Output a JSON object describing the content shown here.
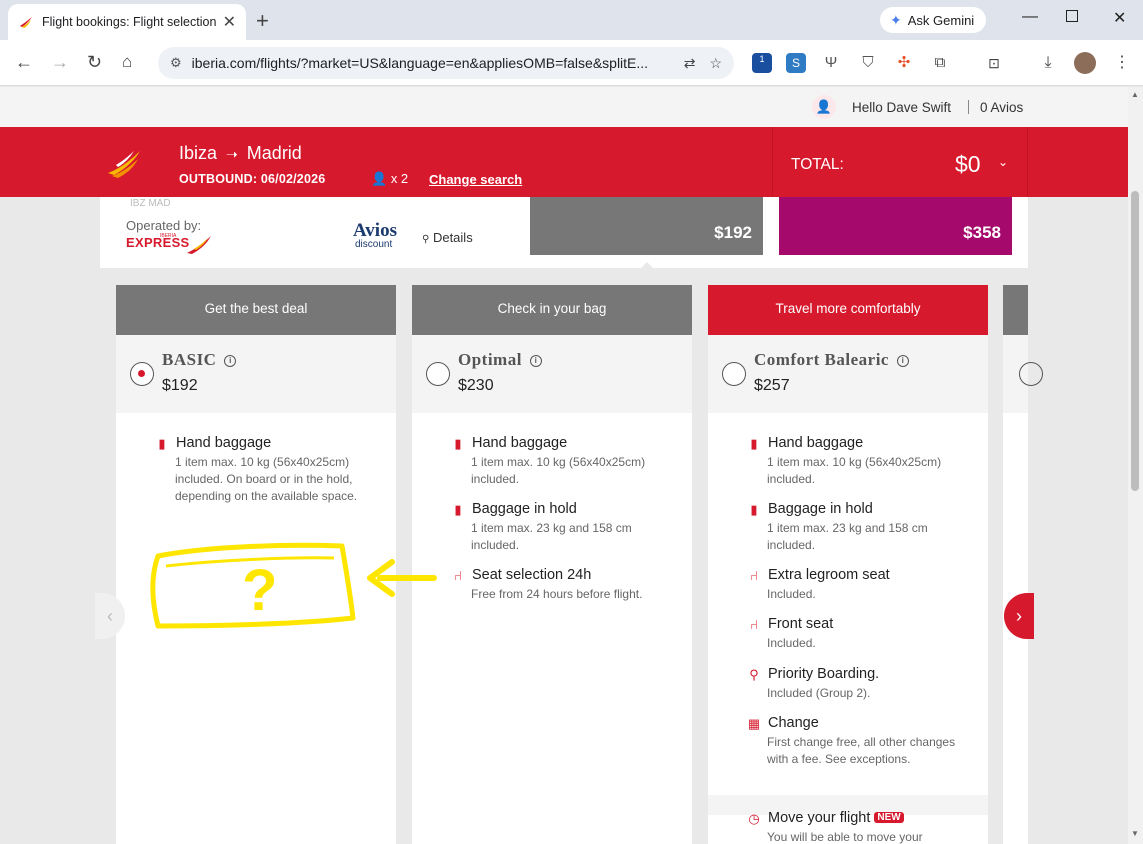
{
  "browser": {
    "tab_title": "Flight bookings: Flight selection",
    "close_tab": "✕",
    "new_tab": "+",
    "gemini_label": "Ask Gemini",
    "url": "iberia.com/flights/?market=US&language=en&appliesOMB=false&splitE...",
    "ext_badge": "1"
  },
  "header": {
    "greeting": "Hello Dave Swift",
    "avios": "0 Avios"
  },
  "booking": {
    "origin": "Ibiza",
    "arrow": "➝",
    "destination": "Madrid",
    "outbound": "OUTBOUND: 06/02/2026",
    "passengers": "x 2",
    "change_search": "Change search",
    "total_label": "TOTAL:",
    "total_value": "$0",
    "total_chevron": "⌄"
  },
  "flight": {
    "cut_codes": "IBZ                                                                 MAD",
    "operated_by": "Operated by:",
    "carrier": "EXPRESS",
    "carrier_sub": "IBERIA",
    "avios_word": "Avios",
    "avios_discount": "discount",
    "details": "Details",
    "price_economy": "$192",
    "price_business": "$358"
  },
  "fares": [
    {
      "header": "Get the best deal",
      "name": "BASIC",
      "price": "$192",
      "features": [
        {
          "title": "Hand baggage",
          "desc": "1 item max. 10 kg (56x40x25cm) included. On board or in the hold, depending on the available space."
        }
      ]
    },
    {
      "header": "Check in your bag",
      "name": "Optimal",
      "price": "$230",
      "features": [
        {
          "title": "Hand baggage",
          "desc": "1 item max. 10 kg (56x40x25cm) included."
        },
        {
          "title": "Baggage in hold",
          "desc": "1 item max. 23 kg and 158 cm included."
        },
        {
          "title": "Seat selection 24h",
          "desc": "Free from 24 hours before flight."
        }
      ]
    },
    {
      "header": "Travel more comfortably",
      "name": "Comfort Balearic",
      "price": "$257",
      "features": [
        {
          "title": "Hand baggage",
          "desc": "1 item max. 10 kg (56x40x25cm) included."
        },
        {
          "title": "Baggage in hold",
          "desc": "1 item max. 23 kg and 158 cm included."
        },
        {
          "title": "Extra legroom seat",
          "desc": "Included."
        },
        {
          "title": "Front seat",
          "desc": "Included."
        },
        {
          "title": "Priority Boarding.",
          "desc": "Included (Group 2)."
        },
        {
          "title": "Change",
          "desc": "First change free, all other changes with a fee. See exceptions."
        },
        {
          "title": "Move your flight",
          "badge": "NEW",
          "desc": "You will be able to move your"
        }
      ]
    }
  ],
  "annotation": {
    "mark": "?"
  },
  "colors": {
    "brand_red": "#d7192d",
    "economy_grey": "#777777",
    "business_purple": "#a5096b",
    "annotation_yellow": "#ffe600"
  }
}
